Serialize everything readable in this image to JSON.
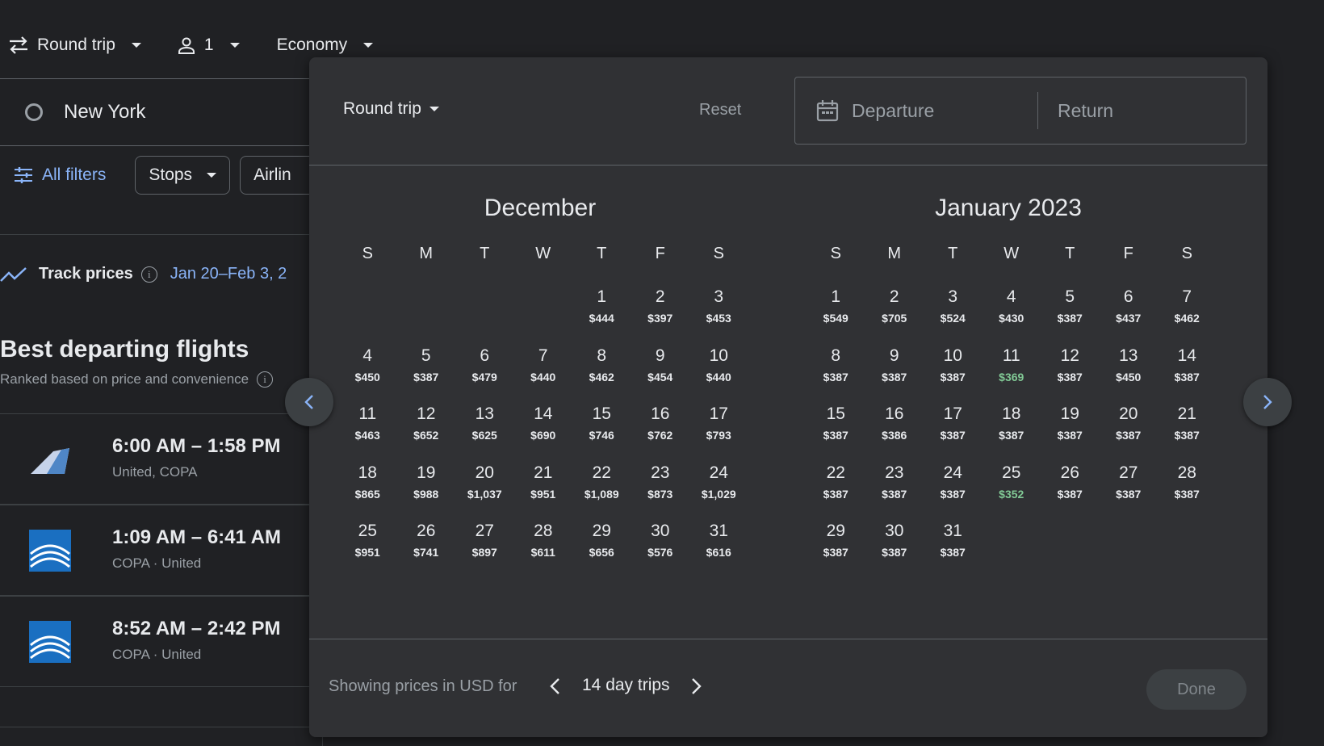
{
  "topbar": {
    "trip_type": "Round trip",
    "passengers": "1",
    "cabin_class": "Economy"
  },
  "search": {
    "origin": "New York"
  },
  "filters": {
    "all_filters": "All filters",
    "stops": "Stops",
    "airlines": "Airlin"
  },
  "track": {
    "label": "Track prices",
    "dates": "Jan 20–Feb 3, 2"
  },
  "results": {
    "title": "Best departing flights",
    "subtitle": "Ranked based on price and convenience",
    "flights": [
      {
        "time": "6:00 AM – 1:58 PM",
        "airlines": "United, COPA",
        "logo": "united-logo"
      },
      {
        "time": "1:09 AM – 6:41 AM",
        "airlines": "COPA · United",
        "logo": "copa-logo"
      },
      {
        "time": "8:52 AM – 2:42 PM",
        "airlines": "COPA · United",
        "logo": "copa-logo"
      }
    ]
  },
  "dialog": {
    "trip_type": "Round trip",
    "reset": "Reset",
    "departure_placeholder": "Departure",
    "return_placeholder": "Return",
    "weekdays": [
      "S",
      "M",
      "T",
      "W",
      "T",
      "F",
      "S"
    ],
    "months": [
      {
        "title": "December",
        "offset": 4,
        "days": [
          {
            "d": "1",
            "p": "$444"
          },
          {
            "d": "2",
            "p": "$397"
          },
          {
            "d": "3",
            "p": "$453"
          },
          {
            "d": "4",
            "p": "$450"
          },
          {
            "d": "5",
            "p": "$387"
          },
          {
            "d": "6",
            "p": "$479"
          },
          {
            "d": "7",
            "p": "$440"
          },
          {
            "d": "8",
            "p": "$462"
          },
          {
            "d": "9",
            "p": "$454"
          },
          {
            "d": "10",
            "p": "$440"
          },
          {
            "d": "11",
            "p": "$463"
          },
          {
            "d": "12",
            "p": "$652"
          },
          {
            "d": "13",
            "p": "$625"
          },
          {
            "d": "14",
            "p": "$690"
          },
          {
            "d": "15",
            "p": "$746"
          },
          {
            "d": "16",
            "p": "$762"
          },
          {
            "d": "17",
            "p": "$793"
          },
          {
            "d": "18",
            "p": "$865"
          },
          {
            "d": "19",
            "p": "$988"
          },
          {
            "d": "20",
            "p": "$1,037"
          },
          {
            "d": "21",
            "p": "$951"
          },
          {
            "d": "22",
            "p": "$1,089"
          },
          {
            "d": "23",
            "p": "$873"
          },
          {
            "d": "24",
            "p": "$1,029"
          },
          {
            "d": "25",
            "p": "$951"
          },
          {
            "d": "26",
            "p": "$741"
          },
          {
            "d": "27",
            "p": "$897"
          },
          {
            "d": "28",
            "p": "$611"
          },
          {
            "d": "29",
            "p": "$656"
          },
          {
            "d": "30",
            "p": "$576"
          },
          {
            "d": "31",
            "p": "$616"
          }
        ]
      },
      {
        "title": "January 2023",
        "offset": 0,
        "days": [
          {
            "d": "1",
            "p": "$549"
          },
          {
            "d": "2",
            "p": "$705"
          },
          {
            "d": "3",
            "p": "$524"
          },
          {
            "d": "4",
            "p": "$430"
          },
          {
            "d": "5",
            "p": "$387"
          },
          {
            "d": "6",
            "p": "$437"
          },
          {
            "d": "7",
            "p": "$462"
          },
          {
            "d": "8",
            "p": "$387"
          },
          {
            "d": "9",
            "p": "$387"
          },
          {
            "d": "10",
            "p": "$387"
          },
          {
            "d": "11",
            "p": "$369",
            "low": true
          },
          {
            "d": "12",
            "p": "$387"
          },
          {
            "d": "13",
            "p": "$450"
          },
          {
            "d": "14",
            "p": "$387"
          },
          {
            "d": "15",
            "p": "$387"
          },
          {
            "d": "16",
            "p": "$386"
          },
          {
            "d": "17",
            "p": "$387"
          },
          {
            "d": "18",
            "p": "$387"
          },
          {
            "d": "19",
            "p": "$387"
          },
          {
            "d": "20",
            "p": "$387"
          },
          {
            "d": "21",
            "p": "$387"
          },
          {
            "d": "22",
            "p": "$387"
          },
          {
            "d": "23",
            "p": "$387"
          },
          {
            "d": "24",
            "p": "$387"
          },
          {
            "d": "25",
            "p": "$352",
            "low": true
          },
          {
            "d": "26",
            "p": "$387"
          },
          {
            "d": "27",
            "p": "$387"
          },
          {
            "d": "28",
            "p": "$387"
          },
          {
            "d": "29",
            "p": "$387"
          },
          {
            "d": "30",
            "p": "$387"
          },
          {
            "d": "31",
            "p": "$387"
          }
        ]
      }
    ],
    "footer_text": "Showing prices in USD for",
    "trip_length": "14 day trips",
    "done": "Done"
  },
  "colors": {
    "background": "#202124",
    "dialog": "#303134",
    "accent": "#8ab4f8",
    "low_price": "#81c995"
  }
}
